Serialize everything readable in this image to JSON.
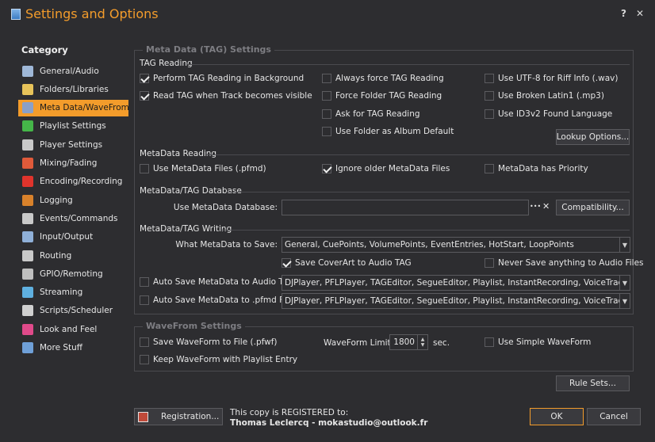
{
  "window": {
    "title": "Settings and Options",
    "help_glyph": "?",
    "close_glyph": "✕"
  },
  "sidebar": {
    "heading": "Category",
    "items": [
      {
        "label": "General/Audio",
        "icon": "music-note-icon",
        "color": "#9fb8d8"
      },
      {
        "label": "Folders/Libraries",
        "icon": "folder-icon",
        "color": "#e7c35a"
      },
      {
        "label": "Meta Data/WaveFrom",
        "icon": "tag-icon",
        "color": "#8aa0c8",
        "selected": true
      },
      {
        "label": "Playlist Settings",
        "icon": "play-icon",
        "color": "#45b649"
      },
      {
        "label": "Player Settings",
        "icon": "player-icon",
        "color": "#c9c9c9"
      },
      {
        "label": "Mixing/Fading",
        "icon": "crossfade-icon",
        "color": "#e05a3a"
      },
      {
        "label": "Encoding/Recording",
        "icon": "record-icon",
        "color": "#e0342c"
      },
      {
        "label": "Logging",
        "icon": "log-icon",
        "color": "#d9822b"
      },
      {
        "label": "Events/Commands",
        "icon": "lightning-icon",
        "color": "#c9c9c9"
      },
      {
        "label": "Input/Output",
        "icon": "io-icon",
        "color": "#8fb0d8"
      },
      {
        "label": "Routing",
        "icon": "routing-icon",
        "color": "#c9c9c9"
      },
      {
        "label": "GPIO/Remoting",
        "icon": "trophy-icon",
        "color": "#bfbfbf"
      },
      {
        "label": "Streaming",
        "icon": "streaming-icon",
        "color": "#5fb0e0"
      },
      {
        "label": "Scripts/Scheduler",
        "icon": "clock-icon",
        "color": "#d0d0d0"
      },
      {
        "label": "Look and Feel",
        "icon": "palette-icon",
        "color": "#e04a8a"
      },
      {
        "label": "More Stuff",
        "icon": "more-stuff-icon",
        "color": "#6fa0d8"
      }
    ]
  },
  "metadata": {
    "group_title": "Meta Data (TAG) Settings",
    "tag_reading": {
      "label": "TAG Reading",
      "perform_bg": {
        "label": "Perform TAG Reading in Background",
        "checked": true
      },
      "read_visible": {
        "label": "Read TAG when Track becomes visible",
        "checked": true
      },
      "always_force": {
        "label": "Always force TAG Reading",
        "checked": false
      },
      "force_folder": {
        "label": "Force Folder TAG Reading",
        "checked": false
      },
      "ask": {
        "label": "Ask for TAG Reading",
        "checked": false
      },
      "folder_album": {
        "label": "Use Folder as Album Default",
        "checked": false
      },
      "utf8": {
        "label": "Use UTF-8 for Riff Info (.wav)",
        "checked": false
      },
      "latin1": {
        "label": "Use Broken Latin1 (.mp3)",
        "checked": false
      },
      "id3v2": {
        "label": "Use ID3v2 Found Language",
        "checked": false
      },
      "lookup_button": "Lookup Options..."
    },
    "metadata_reading": {
      "label": "MetaData Reading",
      "use_pfmd": {
        "label": "Use MetaData Files (.pfmd)",
        "checked": false
      },
      "ignore_older": {
        "label": "Ignore older MetaData Files",
        "checked": true
      },
      "priority": {
        "label": "MetaData has Priority",
        "checked": false
      }
    },
    "database": {
      "label": "MetaData/TAG Database",
      "use_label": "Use MetaData Database:",
      "value": "",
      "browse_glyph": "•••",
      "clear_glyph": "✕",
      "compat_button": "Compatibility..."
    },
    "writing": {
      "label": "MetaData/TAG Writing",
      "what_label": "What MetaData to Save:",
      "what_value": "General, CuePoints, VolumePoints, EventEntries, HotStart, LoopPoints",
      "save_coverart": {
        "label": "Save CoverArt to Audio TAG",
        "checked": true
      },
      "never_save": {
        "label": "Never Save anything to Audio Files",
        "checked": false
      },
      "auto_audio": {
        "label": "Auto Save MetaData to Audio TAG:",
        "checked": false,
        "value": "DJPlayer, PFLPlayer, TAGEditor, SegueEditor, Playlist, InstantRecording, VoiceTracking, Stand..."
      },
      "auto_pfmd": {
        "label": "Auto Save MetaData to .pfmd File:",
        "checked": false,
        "value": "DJPlayer, PFLPlayer, TAGEditor, SegueEditor, Playlist, InstantRecording, VoiceTracking, Stand..."
      }
    }
  },
  "waveform": {
    "group_title": "WaveFrom Settings",
    "save_pfwf": {
      "label": "Save WaveForm to File (.pfwf)",
      "checked": false
    },
    "keep_playlist": {
      "label": "Keep WaveForm with Playlist Entry",
      "checked": false
    },
    "limit_label": "WaveForm Limit:",
    "limit_value": "1800",
    "limit_unit": "sec.",
    "simple": {
      "label": "Use Simple WaveForm",
      "checked": false
    }
  },
  "rule_sets_button": "Rule Sets...",
  "footer": {
    "registration_button": "Registration...",
    "registered_line": "This copy is REGISTERED to:",
    "registered_to": "Thomas Leclercq - mokastudio@outlook.fr",
    "ok_button": "OK",
    "cancel_button": "Cancel",
    "ok_border_color": "#f39c2b"
  }
}
